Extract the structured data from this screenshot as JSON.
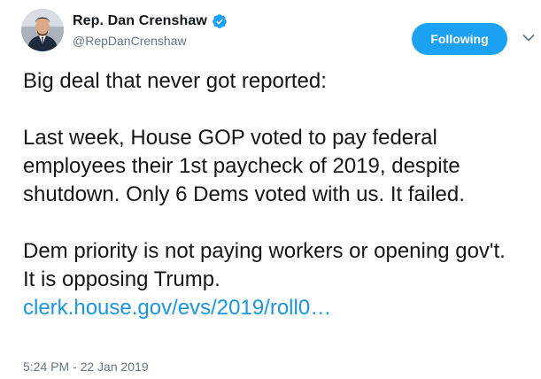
{
  "tweet": {
    "author": {
      "display_name": "Rep. Dan Crenshaw",
      "handle": "@RepDanCrenshaw",
      "verified": true
    },
    "follow_button_label": "Following",
    "body": {
      "paragraph_1": "Big deal that never got reported:",
      "paragraph_2": "Last week, House GOP voted to pay federal employees their 1st paycheck of 2019, despite shutdown. Only 6 Dems voted with us. It failed.",
      "paragraph_3_text": "Dem priority is not paying workers or opening gov't. It is opposing Trump.",
      "link_text": "clerk.house.gov/evs/2019/roll0…"
    },
    "timestamp": "5:24 PM - 22 Jan 2019"
  },
  "colors": {
    "accent": "#1da1f2",
    "link": "#1b95e0",
    "text_primary": "#14171a",
    "text_secondary": "#657786"
  },
  "icons": [
    "avatar",
    "verified-badge-icon",
    "chevron-down-icon"
  ]
}
